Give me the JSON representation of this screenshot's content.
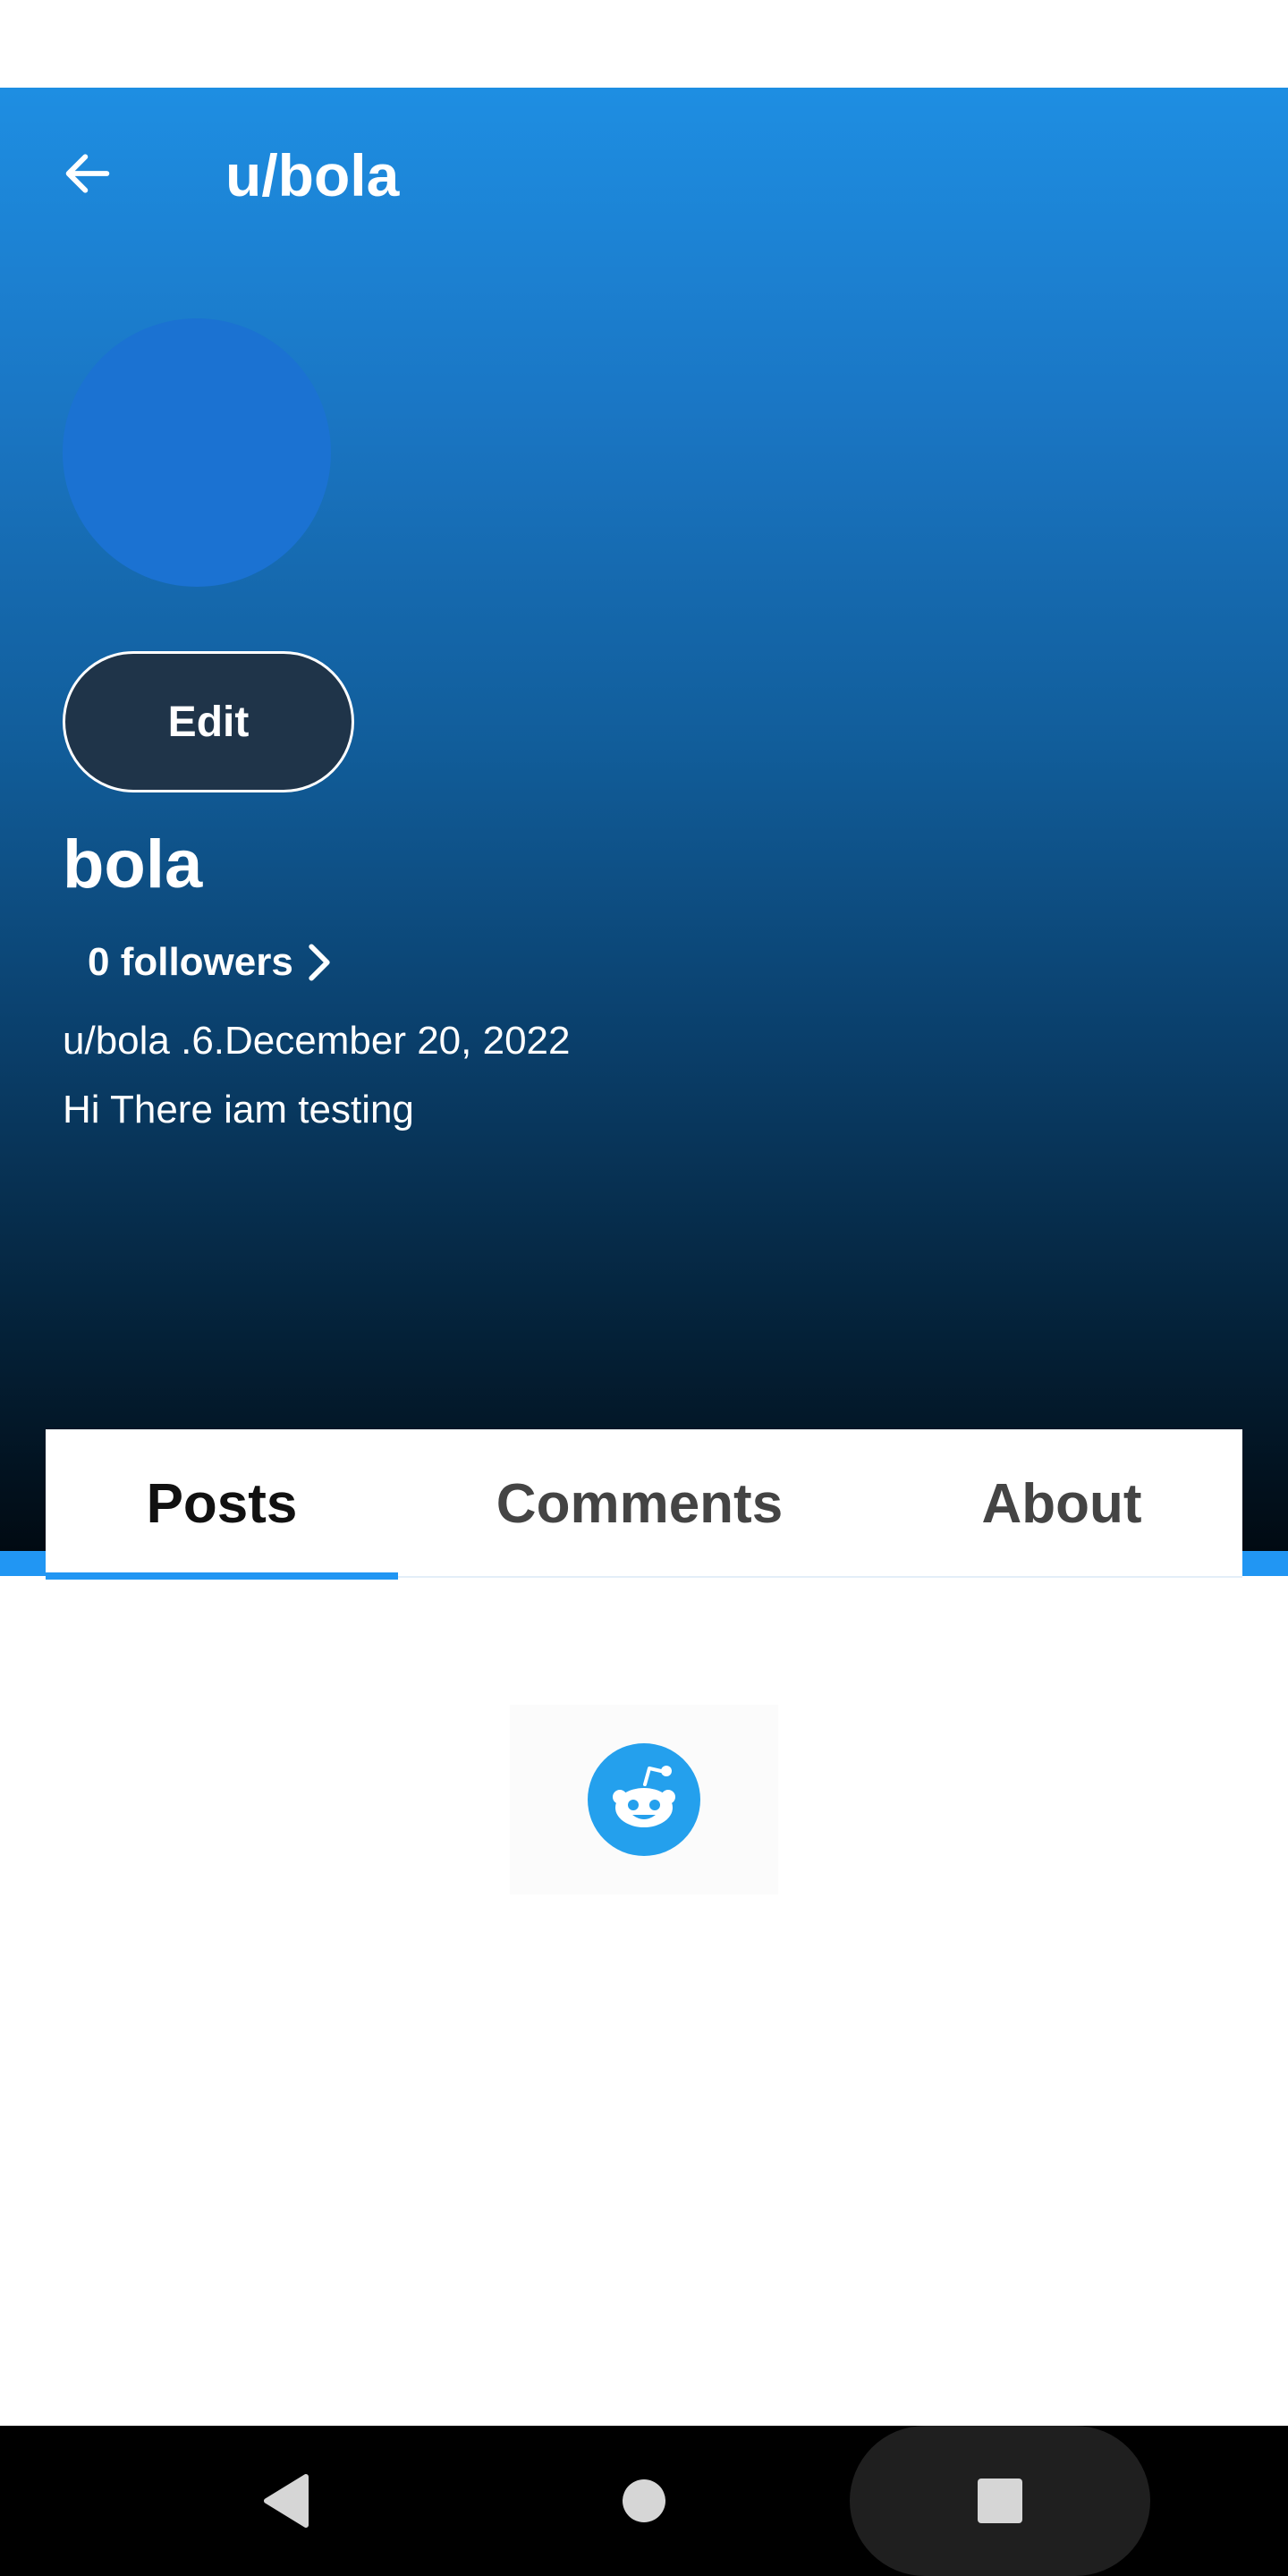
{
  "header": {
    "title": "u/bola",
    "back_icon": "arrow-left-icon"
  },
  "profile": {
    "edit_label": "Edit",
    "display_name": "bola",
    "followers_label": "0 followers",
    "meta_line": "u/bola .6.December 20, 2022",
    "bio": "Hi There iam testing"
  },
  "tabs": [
    {
      "label": "Posts",
      "active": true
    },
    {
      "label": "Comments",
      "active": false
    },
    {
      "label": "About",
      "active": false
    }
  ],
  "empty_state": {
    "icon": "reddit-snoo-icon"
  },
  "system_nav": {
    "back_icon": "nav-back-icon",
    "home_icon": "nav-home-icon",
    "recents_icon": "nav-recents-icon"
  },
  "colors": {
    "accent": "#2196f3",
    "avatar": "#1b72d2",
    "edit_button_bg": "#1f3449",
    "header_gradient_top": "#1e8ee2",
    "header_gradient_bottom": "#010a12"
  }
}
